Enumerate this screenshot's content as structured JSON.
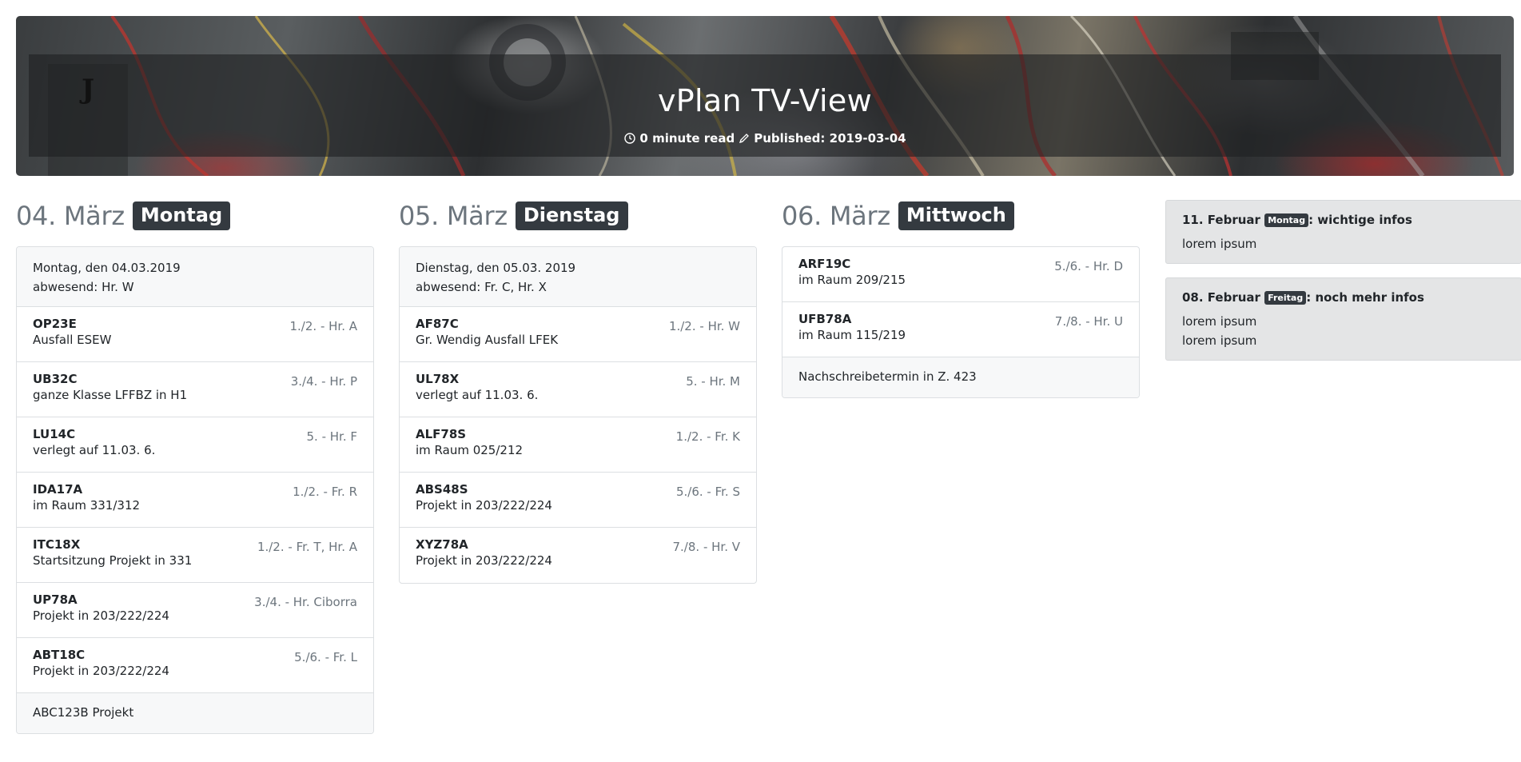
{
  "header": {
    "logo_text": "J",
    "title": "vPlan TV-View",
    "read_time": "0 minute read",
    "published": "Published: 2019-03-04"
  },
  "days": [
    {
      "date": "04. März",
      "weekday": "Montag",
      "top_lines": [
        "Montag, den 04.03.2019",
        "abwesend: Hr. W"
      ],
      "entries": [
        {
          "cls": "OP23E",
          "note": "Ausfall ESEW",
          "teacher": "1./2. - Hr. A"
        },
        {
          "cls": "UB32C",
          "note": "ganze Klasse LFFBZ in H1",
          "teacher": "3./4. - Hr. P"
        },
        {
          "cls": "LU14C",
          "note": "verlegt auf 11.03. 6.",
          "teacher": "5. - Hr. F"
        },
        {
          "cls": "IDA17A",
          "note": "im Raum 331/312",
          "teacher": "1./2. - Fr. R"
        },
        {
          "cls": "ITC18X",
          "note": "Startsitzung Projekt in 331",
          "teacher": "1./2. - Fr. T, Hr. A"
        },
        {
          "cls": "UP78A",
          "note": "Projekt in 203/222/224",
          "teacher": "3./4. - Hr. Ciborra"
        },
        {
          "cls": "ABT18C",
          "note": "Projekt in 203/222/224",
          "teacher": "5./6. - Fr. L"
        }
      ],
      "bottom": "ABC123B Projekt"
    },
    {
      "date": "05. März",
      "weekday": "Dienstag",
      "top_lines": [
        "Dienstag, den 05.03. 2019",
        "abwesend: Fr. C, Hr. X"
      ],
      "entries": [
        {
          "cls": "AF87C",
          "note": "Gr. Wendig Ausfall LFEK",
          "teacher": "1./2. - Hr. W"
        },
        {
          "cls": "UL78X",
          "note": "verlegt auf 11.03. 6.",
          "teacher": "5. - Hr. M"
        },
        {
          "cls": "ALF78S",
          "note": "im Raum 025/212",
          "teacher": "1./2. - Fr. K"
        },
        {
          "cls": "ABS48S",
          "note": "Projekt in 203/222/224",
          "teacher": "5./6. - Fr. S"
        },
        {
          "cls": "XYZ78A",
          "note": "Projekt in 203/222/224",
          "teacher": "7./8. - Hr. V"
        }
      ]
    },
    {
      "date": "06. März",
      "weekday": "Mittwoch",
      "entries": [
        {
          "cls": "ARF19C",
          "note": "im Raum 209/215",
          "teacher": "5./6. - Hr. D"
        },
        {
          "cls": "UFB78A",
          "note": "im Raum 115/219",
          "teacher": "7./8. - Hr. U"
        }
      ],
      "bottom": "Nachschreibetermin in Z. 423"
    }
  ],
  "infos": [
    {
      "date": "11. Februar",
      "weekday": "Montag",
      "title": ": wichtige infos",
      "lines": [
        "lorem ipsum"
      ]
    },
    {
      "date": "08. Februar",
      "weekday": "Freitag",
      "title": ": noch mehr infos",
      "lines": [
        "lorem ipsum",
        "lorem ipsum"
      ]
    }
  ]
}
